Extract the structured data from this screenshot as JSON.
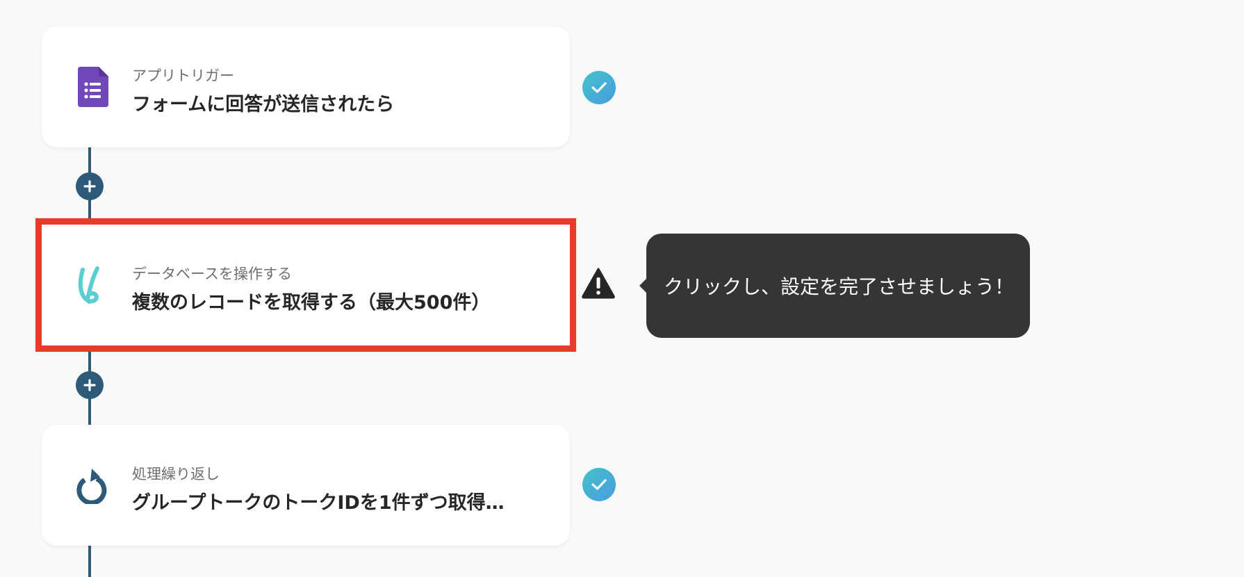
{
  "steps": [
    {
      "label": "アプリトリガー",
      "title": "フォームに回答が送信されたら",
      "icon": "google-forms-icon",
      "status": "complete"
    },
    {
      "label": "データベースを操作する",
      "title": "複数のレコードを取得する（最大500件）",
      "icon": "yoom-database-icon",
      "status": "warning"
    },
    {
      "label": "処理繰り返し",
      "title": "グループトークのトークIDを1件ずつ取得…",
      "icon": "loop-icon",
      "status": "complete"
    }
  ],
  "tooltip": {
    "text": "クリックし、設定を完了させましょう！"
  },
  "colors": {
    "accent": "#2d5a78",
    "highlight": "#e63b28",
    "tooltip_bg": "#353535",
    "check_gradient_start": "#43c3c8",
    "check_gradient_end": "#4a9be0",
    "forms_purple": "#7248b9",
    "db_teal": "#5ccdd0"
  }
}
